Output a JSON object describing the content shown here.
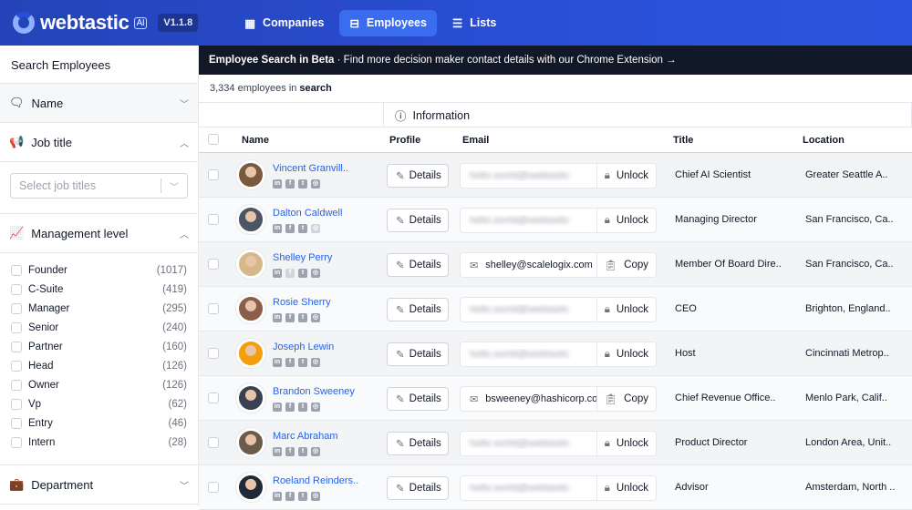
{
  "header": {
    "brand": "webtastic",
    "ai_badge": "AI",
    "version": "V1.1.8",
    "nav": [
      {
        "label": "Companies",
        "icon": "building-icon"
      },
      {
        "label": "Employees",
        "icon": "briefcase-icon",
        "active": true
      },
      {
        "label": "Lists",
        "icon": "list-icon"
      }
    ]
  },
  "sidebar": {
    "title": "Search Employees",
    "sections": {
      "name": "Name",
      "job_title": "Job title",
      "management": "Management level",
      "department": "Department"
    },
    "job_title_placeholder": "Select job titles",
    "levels": [
      {
        "label": "Founder",
        "count": "(1017)"
      },
      {
        "label": "C-Suite",
        "count": "(419)"
      },
      {
        "label": "Manager",
        "count": "(295)"
      },
      {
        "label": "Senior",
        "count": "(240)"
      },
      {
        "label": "Partner",
        "count": "(160)"
      },
      {
        "label": "Head",
        "count": "(126)"
      },
      {
        "label": "Owner",
        "count": "(126)"
      },
      {
        "label": "Vp",
        "count": "(62)"
      },
      {
        "label": "Entry",
        "count": "(46)"
      },
      {
        "label": "Intern",
        "count": "(28)"
      }
    ]
  },
  "banner": {
    "bold": "Employee Search in Beta",
    "sep": "·",
    "text": "Find more decision maker contact details with our Chrome Extension",
    "arrow": "→"
  },
  "count": {
    "number": "3,334 employees in",
    "suffix": "search"
  },
  "info_header": "Information",
  "columns": {
    "name": "Name",
    "profile": "Profile",
    "email": "Email",
    "title": "Title",
    "location": "Location"
  },
  "details_label": "Details",
  "rows": [
    {
      "name": "Vincent Granvill..",
      "email": "hello.world@webtastic",
      "locked": true,
      "action": "Unlock",
      "title": "Chief AI Scientist",
      "location": "Greater Seattle A..",
      "avatar": "#7a5a3c"
    },
    {
      "name": "Dalton Caldwell",
      "email": "hello.world@webtastic",
      "locked": true,
      "action": "Unlock",
      "title": "Managing Director",
      "location": "San Francisco, Ca..",
      "avatar": "#4b5563"
    },
    {
      "name": "Shelley Perry",
      "email": "shelley@scalelogix.com",
      "locked": false,
      "action": "Copy",
      "title": "Member Of Board Dire..",
      "location": "San Francisco, Ca..",
      "avatar": "#d6b98a"
    },
    {
      "name": "Rosie Sherry",
      "email": "hello.world@webtastic",
      "locked": true,
      "action": "Unlock",
      "title": "CEO",
      "location": "Brighton, England..",
      "avatar": "#8b5e4a"
    },
    {
      "name": "Joseph Lewin",
      "email": "hello.world@webtastic",
      "locked": true,
      "action": "Unlock",
      "title": "Host",
      "location": "Cincinnati Metrop..",
      "avatar": "#f59e0b"
    },
    {
      "name": "Brandon Sweeney",
      "email": "bsweeney@hashicorp.co",
      "locked": false,
      "action": "Copy",
      "title": "Chief Revenue Office..",
      "location": "Menlo Park, Calif..",
      "avatar": "#374151"
    },
    {
      "name": "Marc Abraham",
      "email": "hello.world@webtastic",
      "locked": true,
      "action": "Unlock",
      "title": "Product Director",
      "location": "London Area, Unit..",
      "avatar": "#6b5b4a"
    },
    {
      "name": "Roeland Reinders..",
      "email": "hello.world@webtastic",
      "locked": true,
      "action": "Unlock",
      "title": "Advisor",
      "location": "Amsterdam, North ..",
      "avatar": "#1f2937"
    }
  ]
}
